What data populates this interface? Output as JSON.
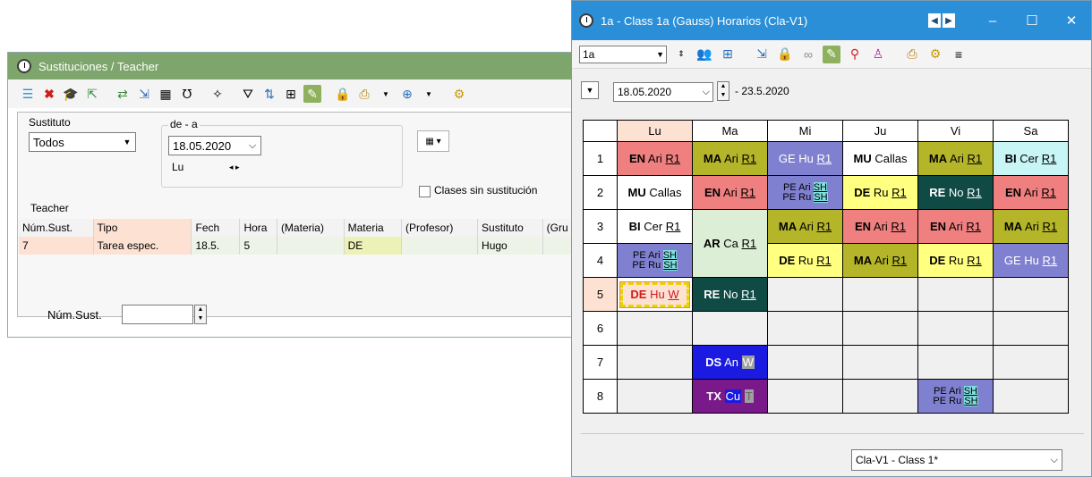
{
  "sub_window": {
    "title": "Sustituciones / Teacher",
    "sustituto_label": "Sustituto",
    "sustituto_value": "Todos",
    "date_range_label": "de - a",
    "date_value": "18.05.2020",
    "day_label": "Lu",
    "checkbox_label": "Clases sin sustitución",
    "section_label": "Teacher",
    "table_headers": [
      "Núm.Sust.",
      "Tipo",
      "Fech",
      "Hora",
      "(Materia)",
      "Materia",
      "(Profesor)",
      "Sustituto",
      "(Gru"
    ],
    "table_rows": [
      [
        "7",
        "Tarea espec.",
        "18.5.",
        "5",
        "",
        "DE",
        "",
        "Hugo",
        ""
      ]
    ],
    "num_sust_label": "Núm.Sust.",
    "colors": {
      "title_bg": "#7ea56b"
    }
  },
  "tt_window": {
    "title": "1a - Class 1a (Gauss)  Horarios  (Cla-V1)",
    "class_select": "1a",
    "date_value": "18.05.2020",
    "date_end": "- 23.5.2020",
    "footer_select": "Cla-V1 - Class 1*",
    "days": [
      "Lu",
      "Ma",
      "Mi",
      "Ju",
      "Vi",
      "Sa"
    ],
    "hours": [
      "1",
      "2",
      "3",
      "4",
      "5",
      "6",
      "7",
      "8"
    ],
    "colors": {
      "title_bg": "#2b8fd8"
    },
    "lessons": {
      "lu_1": {
        "subj": "EN",
        "teacher": "Ari",
        "room": "R1"
      },
      "ma_1": {
        "subj": "MA",
        "teacher": "Ari",
        "room": "R1"
      },
      "mi_1": {
        "subj": "GE",
        "teacher": "Hu",
        "room": "R1"
      },
      "ju_1": {
        "subj": "MU",
        "teacher": "Callas"
      },
      "vi_1": {
        "subj": "MA",
        "teacher": "Ari",
        "room": "R1"
      },
      "sa_1": {
        "subj": "BI",
        "teacher": "Cer",
        "room": "R1"
      },
      "lu_2": {
        "subj": "MU",
        "teacher": "Callas"
      },
      "ma_2": {
        "subj": "EN",
        "teacher": "Ari",
        "room": "R1"
      },
      "mi_2a": {
        "subj": "PE",
        "teacher": "Ari",
        "room": "SH"
      },
      "mi_2b": {
        "subj": "PE",
        "teacher": "Ru",
        "room": "SH"
      },
      "ju_2": {
        "subj": "DE",
        "teacher": "Ru",
        "room": "R1"
      },
      "vi_2": {
        "subj": "RE",
        "teacher": "No",
        "room": "R1"
      },
      "sa_2": {
        "subj": "EN",
        "teacher": "Ari",
        "room": "R1"
      },
      "lu_3": {
        "subj": "BI",
        "teacher": "Cer",
        "room": "R1"
      },
      "ma_34": {
        "subj": "AR",
        "teacher": "Ca",
        "room": "R1"
      },
      "mi_3": {
        "subj": "MA",
        "teacher": "Ari",
        "room": "R1"
      },
      "ju_3": {
        "subj": "EN",
        "teacher": "Ari",
        "room": "R1"
      },
      "vi_3": {
        "subj": "EN",
        "teacher": "Ari",
        "room": "R1"
      },
      "sa_3": {
        "subj": "MA",
        "teacher": "Ari",
        "room": "R1"
      },
      "lu_4a": {
        "subj": "PE",
        "teacher": "Ari",
        "room": "SH"
      },
      "lu_4b": {
        "subj": "PE",
        "teacher": "Ru",
        "room": "SH"
      },
      "mi_4": {
        "subj": "DE",
        "teacher": "Ru",
        "room": "R1"
      },
      "ju_4": {
        "subj": "MA",
        "teacher": "Ari",
        "room": "R1"
      },
      "vi_4": {
        "subj": "DE",
        "teacher": "Ru",
        "room": "R1"
      },
      "sa_4": {
        "subj": "GE",
        "teacher": "Hu",
        "room": "R1"
      },
      "lu_5": {
        "subj": "DE",
        "teacher": "Hu",
        "room": "W"
      },
      "ma_5": {
        "subj": "RE",
        "teacher": "No",
        "room": "R1"
      },
      "ma_7": {
        "subj": "DS",
        "teacher": "An",
        "room": "W"
      },
      "ma_8": {
        "subj": "TX",
        "teacher": "Cu",
        "room": "T"
      },
      "vi_8a": {
        "subj": "PE",
        "teacher": "Ari",
        "room": "SH"
      },
      "vi_8b": {
        "subj": "PE",
        "teacher": "Ru",
        "room": "SH"
      }
    }
  }
}
